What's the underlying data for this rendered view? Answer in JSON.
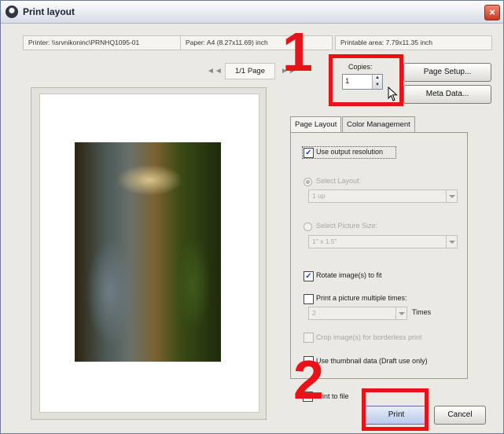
{
  "window": {
    "title": "Print layout",
    "close_glyph": "×"
  },
  "info": {
    "printer": "Printer: \\\\srvnikoninc\\PRNHQ1095-01",
    "paper": "Paper: A4 (8.27x11.69) inch",
    "printable_area": "Printable area: 7.79x11.35 inch"
  },
  "pager": {
    "prev_glyph": "◄◄",
    "page": "1/1 Page",
    "next_glyph": "►►"
  },
  "copies": {
    "label": "Copies:",
    "value": "1"
  },
  "buttons": {
    "page_setup": "Page Setup...",
    "meta_data": "Meta Data...",
    "print": "Print",
    "cancel": "Cancel"
  },
  "tabs": [
    {
      "label": "Page Layout",
      "active": true
    },
    {
      "label": "Color Management",
      "active": false
    }
  ],
  "page_layout": {
    "use_output_resolution": "Use output resolution",
    "select_layout": "Select Layout:",
    "layout_value": "1 up",
    "select_picture_size": "Select Picture Size:",
    "picture_size_value": "1\" x 1.5\"",
    "rotate_to_fit": "Rotate image(s) to fit",
    "print_multiple": "Print a picture multiple times:",
    "times_value": "2",
    "times_label": "Times",
    "crop_borderless": "Crop image(s) for borderless print",
    "use_thumbnail": "Use thumbnail data (Draft use only)"
  },
  "print_to_file": "Print to file",
  "annotations": {
    "step1": "1",
    "step2": "2",
    "highlight_color": "#e81218"
  },
  "icons": {
    "app": "app-logo-icon",
    "close": "close-icon",
    "checkmark": "checkmark-icon",
    "cursor": "mouse-pointer-icon"
  },
  "checkmark_glyph": "✓"
}
